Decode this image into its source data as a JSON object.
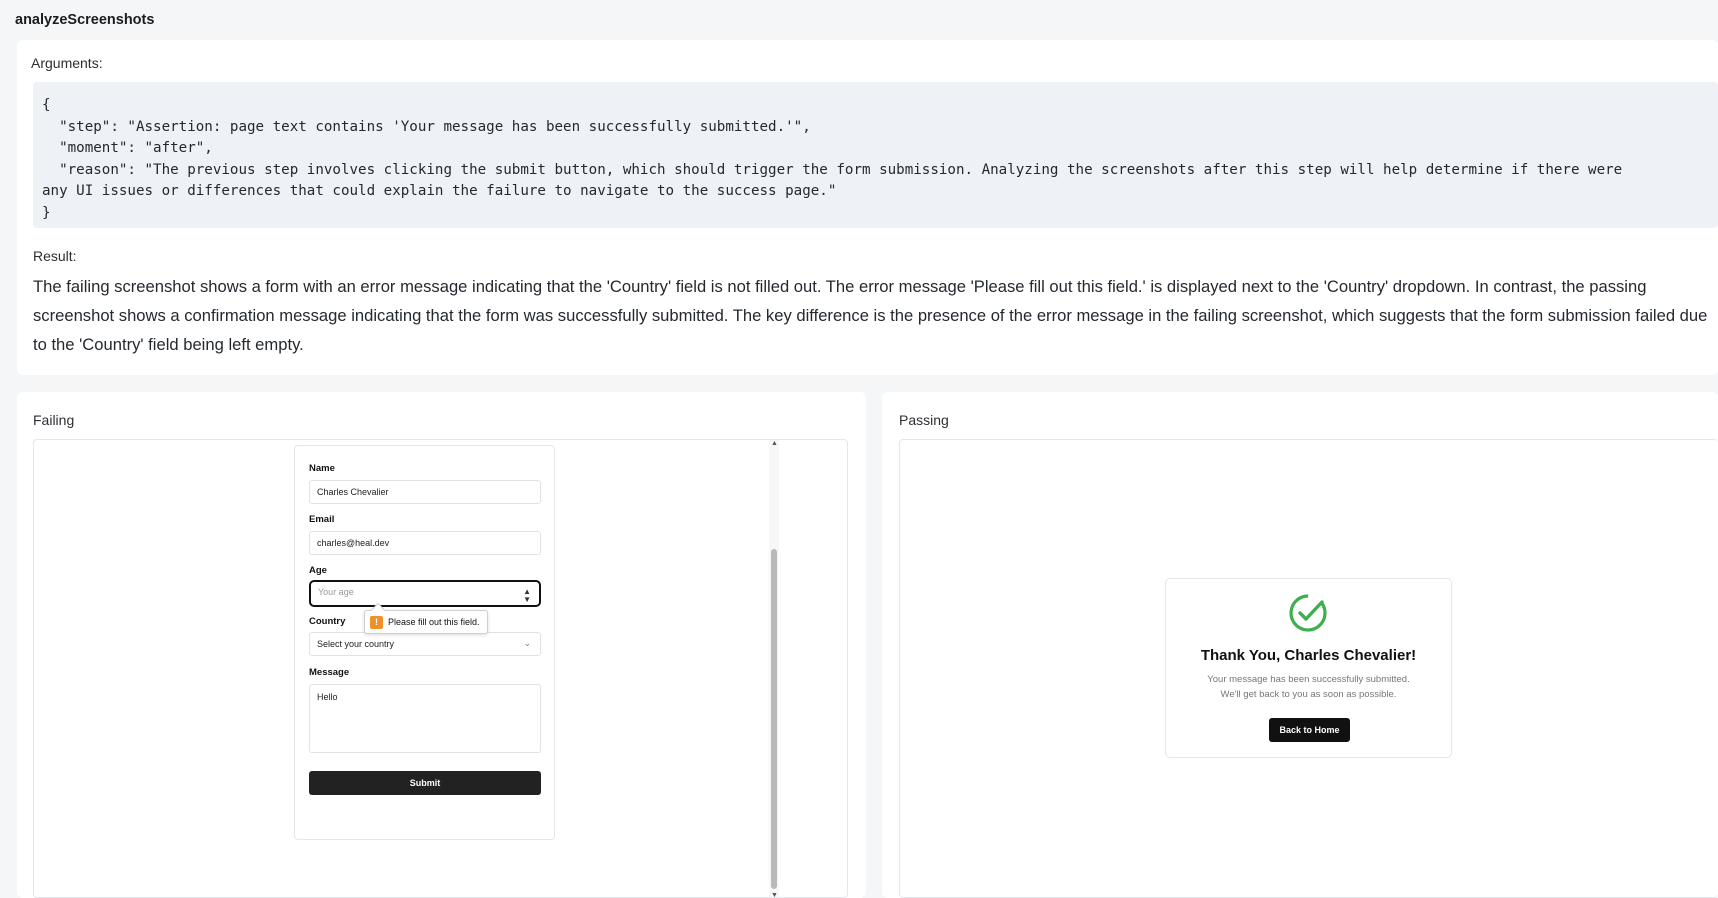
{
  "tool_name": "analyzeScreenshots",
  "arguments": {
    "label": "Arguments:",
    "code_lines": [
      "{",
      "  \"step\": \"Assertion: page text contains 'Your message has been successfully submitted.'\",",
      "  \"moment\": \"after\",",
      "  \"reason\": \"The previous step involves clicking the submit button, which should trigger the form submission. Analyzing the screenshots after this step will help determine if there were",
      "any UI issues or differences that could explain the failure to navigate to the success page.\"",
      "}"
    ]
  },
  "result": {
    "label": "Result:",
    "text": "The failing screenshot shows a form with an error message indicating that the 'Country' field is not filled out. The error message 'Please fill out this field.' is displayed next to the 'Country' dropdown. In contrast, the passing screenshot shows a confirmation message indicating that the form was successfully submitted. The key difference is the presence of the error message in the failing screenshot, which suggests that the form submission failed due to the 'Country' field being left empty."
  },
  "failing": {
    "label": "Failing",
    "form": {
      "name_label": "Name",
      "name_value": "Charles Chevalier",
      "email_label": "Email",
      "email_value": "charles@heal.dev",
      "age_label": "Age",
      "age_placeholder": "Your age",
      "country_label": "Country",
      "country_placeholder": "Select your country",
      "tooltip_text": "Please fill out this field.",
      "message_label": "Message",
      "message_value": "Hello",
      "submit_label": "Submit"
    }
  },
  "passing": {
    "label": "Passing",
    "title": "Thank You, Charles Chevalier!",
    "line1": "Your message has been successfully submitted.",
    "line2": "We'll get back to you as soon as possible.",
    "button_label": "Back to Home"
  },
  "colors": {
    "page_bg": "#f5f6f8",
    "code_bg": "#eef1f5",
    "success_green": "#3fae4f",
    "warning_orange": "#f0902a",
    "button_dark": "#222222"
  },
  "icons": [
    "check-circle-icon",
    "warning-icon",
    "chevron-down-icon",
    "spinner-arrows-icon"
  ]
}
